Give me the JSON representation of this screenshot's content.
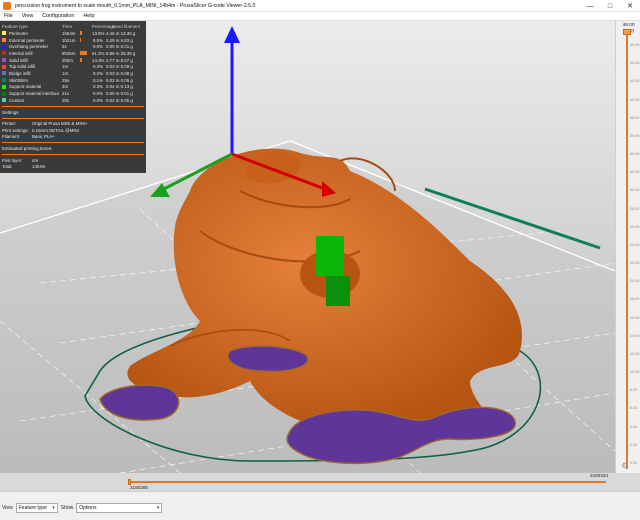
{
  "window": {
    "title": "percussion frog instrument to scale mouth_0.1mm_PLA_MINI_14h4m - PrusaSlicer G-code Viewer-2.5.0",
    "controls": [
      "—",
      "□",
      "✕"
    ]
  },
  "menu": [
    "File",
    "View",
    "Configuration",
    "Help"
  ],
  "legend": {
    "headers": {
      "feature": "Feature type",
      "time": "Time",
      "percentage": "Percentage",
      "used": "Used filament"
    },
    "rows": [
      {
        "name": "Perimeter",
        "color": "#ffe94b",
        "time": "1h54m",
        "pct": "13.5%",
        "pct_value": 13.5,
        "used": "4.46 m  13.30 g"
      },
      {
        "name": "External perimeter",
        "color": "#ff7d38",
        "time": "1h21m",
        "pct": "9.5%",
        "pct_value": 9.5,
        "used": "2.29 m  6.83 g"
      },
      {
        "name": "Overhang perimeter",
        "color": "#1f1fff",
        "time": "5s",
        "pct": "0.0%",
        "pct_value": 0.0,
        "used": "0.00 m  0.01 g"
      },
      {
        "name": "Internal infill",
        "color": "#b03029",
        "time": "8h36m",
        "pct": "61.2%",
        "pct_value": 61.2,
        "used": "8.85 m  26.39 g"
      },
      {
        "name": "Solid infill",
        "color": "#9654cc",
        "time": "2h0m",
        "pct": "14.3%",
        "pct_value": 14.3,
        "used": "2.77 m  8.27 g"
      },
      {
        "name": "Top solid infill",
        "color": "#f04040",
        "time": "1m",
        "pct": "0.2%",
        "pct_value": 0.2,
        "used": "0.03 m  0.09 g"
      },
      {
        "name": "Bridge infill",
        "color": "#4d80ba",
        "time": "1m",
        "pct": "0.2%",
        "pct_value": 0.2,
        "used": "0.03 m  0.08 g"
      },
      {
        "name": "Skirt/Brim",
        "color": "#00876e",
        "time": "25s",
        "pct": "0.1%",
        "pct_value": 0.1,
        "used": "0.02 m  0.05 g"
      },
      {
        "name": "Support material",
        "color": "#00ff00",
        "time": "3m",
        "pct": "0.3%",
        "pct_value": 0.3,
        "used": "0.04 m  0.13 g"
      },
      {
        "name": "Support material interface",
        "color": "#008000",
        "time": "21s",
        "pct": "0.0%",
        "pct_value": 0.0,
        "used": "0.00 m  0.01 g"
      },
      {
        "name": "Custom",
        "color": "#5ed19d",
        "time": "20s",
        "pct": "0.0%",
        "pct_value": 0.0,
        "used": "0.02 m  0.05 g"
      }
    ],
    "settings": {
      "title": "Settings",
      "items": [
        {
          "key": "Printer:",
          "value": "Original Prusa MINI & MINI+"
        },
        {
          "key": "Print settings:",
          "value": "0.15mm DETAIL @MINI"
        },
        {
          "key": "Filament:",
          "value": "Basic PLA+"
        }
      ]
    },
    "estimated": {
      "title": "Estimated printing times:",
      "items": [
        {
          "key": "First layer:",
          "value": "4m"
        },
        {
          "key": "Total:",
          "value": "14h4m"
        }
      ]
    }
  },
  "ruler": {
    "top_value": "48.00",
    "top_index": "(330)",
    "ticks": [
      "46.00",
      "44.00",
      "42.00",
      "40.00",
      "38.00",
      "36.00",
      "34.00",
      "32.00",
      "30.00",
      "28.00",
      "26.00",
      "24.00",
      "22.00",
      "20.00",
      "18.00",
      "16.00",
      "14.00",
      "12.00",
      "10.00",
      "8.00",
      "6.00",
      "4.00",
      "2.00",
      "0.20"
    ]
  },
  "hslider": {
    "right_value": "2160334",
    "left_value": "2160285"
  },
  "bottom": {
    "view_label": "View",
    "view_value": "Feature type",
    "show_label": "Show",
    "show_value": "Options"
  },
  "colors": {
    "model": "#d2671f",
    "brim": "#00876e",
    "solid_infill": "#6b3fa8",
    "axis_x": "#1aa01a",
    "axis_y": "#1a1aff",
    "axis_z": "#d40000",
    "accent": "#e87a1d"
  }
}
